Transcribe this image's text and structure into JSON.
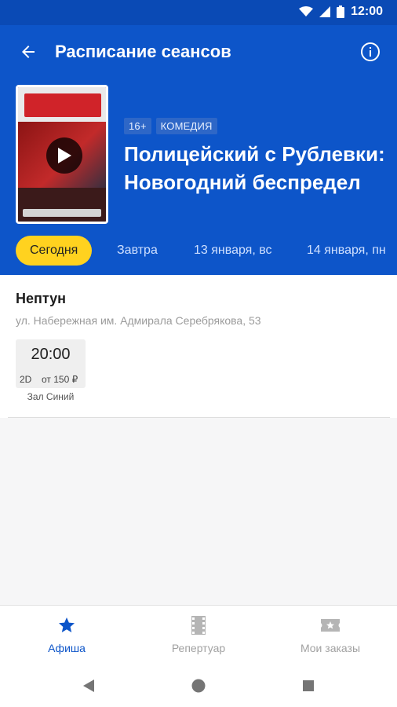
{
  "statusbar": {
    "time": "12:00",
    "icons": [
      "wifi-icon",
      "signal-icon",
      "battery-icon"
    ]
  },
  "header": {
    "title": "Расписание сеансов",
    "back_icon": "arrow-left-icon",
    "info_icon": "info-icon",
    "tags": {
      "age": "16+",
      "genre": "КОМЕДИЯ"
    },
    "movie_title": "Полицейский с Рублевки: Новогодний беспредел"
  },
  "dates": [
    "Сегодня",
    "Завтра",
    "13 января, вс",
    "14 января, пн"
  ],
  "cinema": {
    "name": "Нептун",
    "address": "ул. Набережная им. Адмирала Серебрякова, 53",
    "session": {
      "time": "20:00",
      "format": "2D",
      "price": "от 150 ₽",
      "hall": "Зал Синий"
    }
  },
  "bottom_nav": [
    {
      "label": "Афиша",
      "icon": "star-icon",
      "active": true
    },
    {
      "label": "Репертуар",
      "icon": "film-icon",
      "active": false
    },
    {
      "label": "Мои заказы",
      "icon": "ticket-icon",
      "active": false
    }
  ],
  "colors": {
    "primary": "#0d55c9",
    "accent": "#ffd21f",
    "statusbar": "#0a4ab5"
  }
}
